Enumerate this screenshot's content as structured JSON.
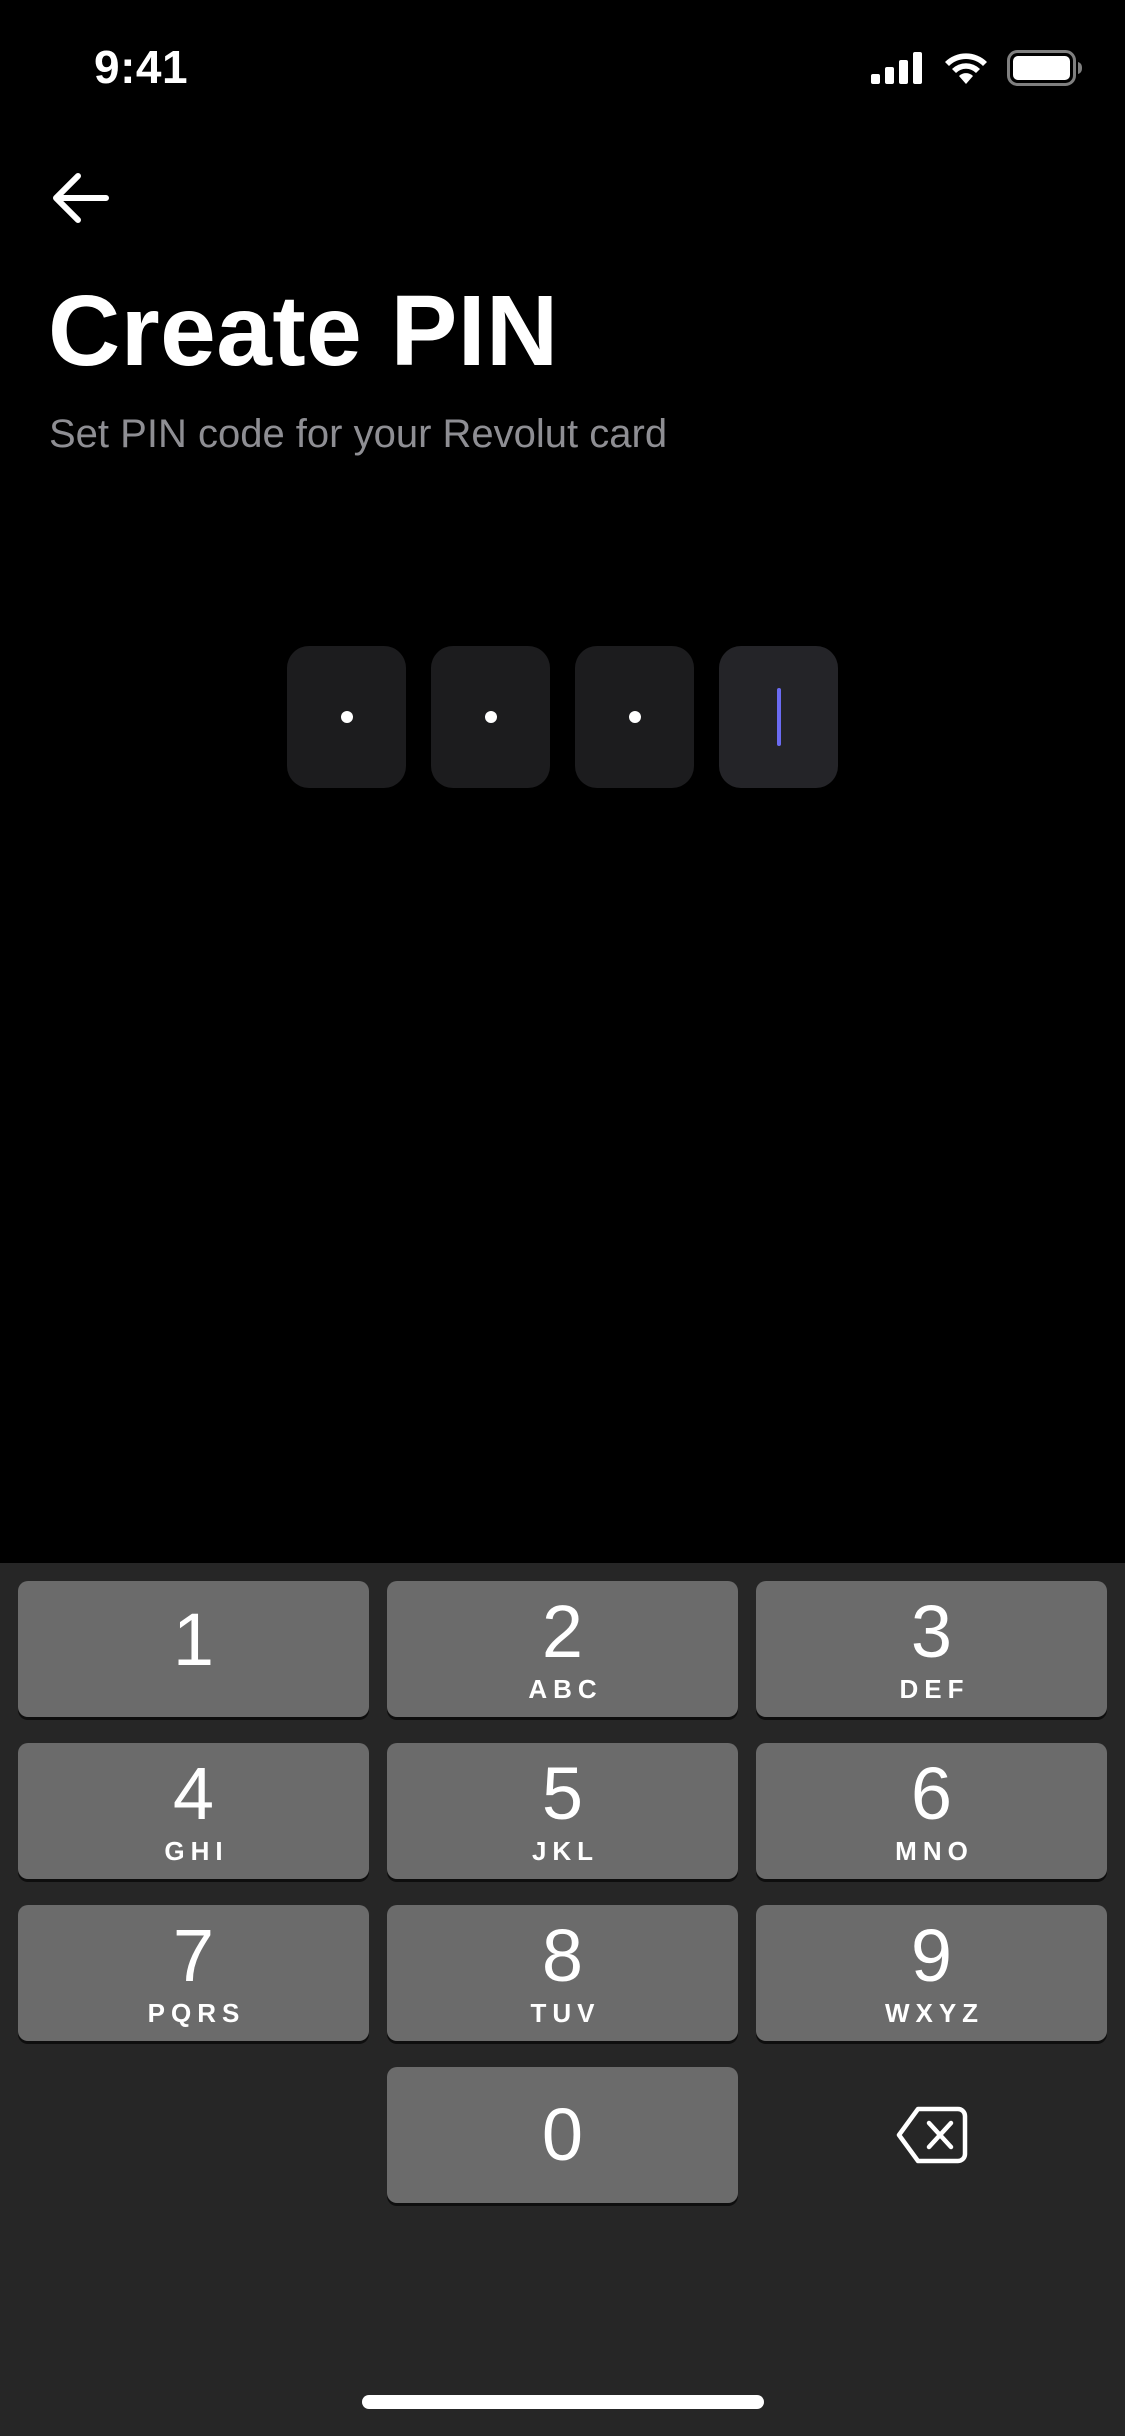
{
  "status_bar": {
    "time": "9:41",
    "icons": [
      "cellular-signal-icon",
      "wifi-icon",
      "battery-icon"
    ]
  },
  "nav": {
    "back_icon": "arrow-left-icon"
  },
  "header": {
    "title": "Create PIN",
    "subtitle": "Set PIN code for your Revolut card"
  },
  "pin": {
    "length": 4,
    "filled": 3,
    "cursor_color": "#6b6bf2"
  },
  "keyboard": {
    "keys": [
      {
        "digit": "1",
        "letters": ""
      },
      {
        "digit": "2",
        "letters": "ABC"
      },
      {
        "digit": "3",
        "letters": "DEF"
      },
      {
        "digit": "4",
        "letters": "GHI"
      },
      {
        "digit": "5",
        "letters": "JKL"
      },
      {
        "digit": "6",
        "letters": "MNO"
      },
      {
        "digit": "7",
        "letters": "PQRS"
      },
      {
        "digit": "8",
        "letters": "TUV"
      },
      {
        "digit": "9",
        "letters": "WXYZ"
      },
      {
        "digit": "0",
        "letters": ""
      }
    ],
    "delete_icon": "backspace-icon"
  },
  "colors": {
    "background": "#000000",
    "subtitle": "#8e8e93",
    "pin_box": "#1c1c1e",
    "keyboard_bg": "#262626",
    "key_bg": "#6b6b6b"
  }
}
